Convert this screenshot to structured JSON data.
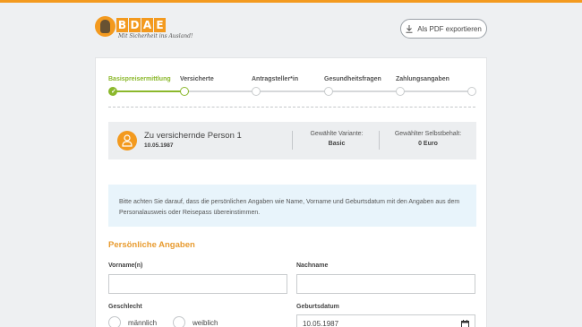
{
  "header": {
    "logo_letters": [
      "B",
      "D",
      "A",
      "E"
    ],
    "logo_tagline": "Mit Sicherheit ins Ausland!",
    "export_button": "Als PDF exportieren"
  },
  "steps": [
    {
      "label": "Basispreisermittlung",
      "state": "done"
    },
    {
      "label": "Versicherte",
      "state": "current"
    },
    {
      "label": "Antragsteller*in",
      "state": "todo"
    },
    {
      "label": "Gesundheitsfragen",
      "state": "todo"
    },
    {
      "label": "Zahlungsangaben",
      "state": "todo"
    },
    {
      "label": "",
      "state": "todo"
    }
  ],
  "person": {
    "title": "Zu versichernde Person 1",
    "dob": "10.05.1987",
    "variant_label": "Gewählte Variante:",
    "variant_value": "Basic",
    "deductible_label": "Gewählter Selbstbehalt:",
    "deductible_value": "0 Euro"
  },
  "notice": "Bitte achten Sie darauf, dass die persönlichen Angaben wie Name, Vorname und Geburtsdatum mit den Angaben aus dem Personalausweis oder Reisepass übereinstimmen.",
  "form": {
    "section_title": "Persönliche Angaben",
    "firstname_label": "Vorname(n)",
    "firstname_value": "",
    "lastname_label": "Nachname",
    "lastname_value": "",
    "gender_label": "Geschlecht",
    "gender_options": [
      "männlich",
      "weiblich"
    ],
    "birthdate_label": "Geburtsdatum",
    "birthdate_value": "10.05.1987"
  },
  "colors": {
    "accent": "#f39a1f",
    "progress": "#8bb82c",
    "section_title": "#e89b2f",
    "notice_bg": "#e8f4fb"
  },
  "icons": [
    "download-icon",
    "person-icon",
    "check-icon",
    "calendar-icon"
  ]
}
